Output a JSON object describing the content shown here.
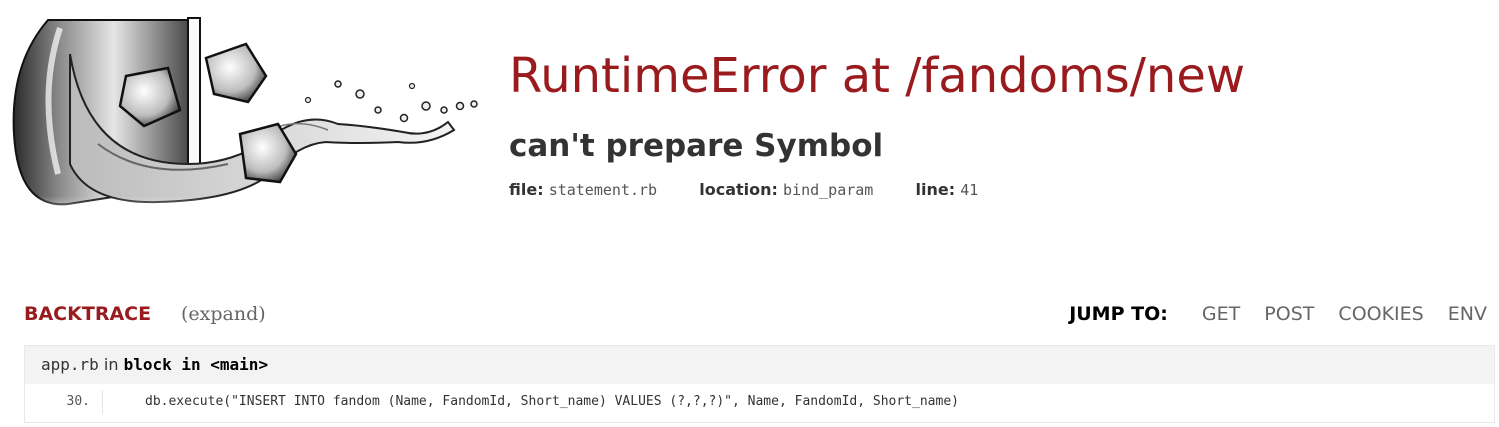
{
  "error": {
    "title": "RuntimeError at /fandoms/new",
    "message": "can't prepare Symbol",
    "file_label": "file:",
    "file_value": "statement.rb",
    "location_label": "location:",
    "location_value": "bind_param",
    "line_label": "line:",
    "line_value": "41"
  },
  "backtrace": {
    "title": "BACKTRACE",
    "expand_label": "(expand)"
  },
  "jump_to": {
    "label": "JUMP TO:",
    "links": [
      "GET",
      "POST",
      "COOKIES",
      "ENV"
    ]
  },
  "frame": {
    "file": "app.rb",
    "in": "in",
    "function": "block in <main>",
    "line_number": "30.",
    "code": "db.execute(\"INSERT INTO fandom (Name, FandomId, Short_name) VALUES (?,?,?)\", Name, FandomId, Short_name)"
  },
  "colors": {
    "title_red": "#9a1b1e",
    "frame_header_bg": "#f3f3f3"
  }
}
